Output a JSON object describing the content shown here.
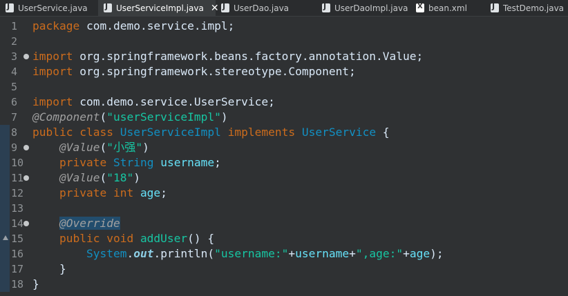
{
  "tabs": [
    {
      "label": "UserService.java",
      "icon": "java-file-icon",
      "active": false
    },
    {
      "label": "UserServiceImpl.java",
      "icon": "java-file-icon",
      "active": true
    },
    {
      "label": "UserDao.java",
      "icon": "java-file-icon",
      "active": false
    },
    {
      "label": "UserDaoImpl.java",
      "icon": "java-file-icon",
      "active": false
    },
    {
      "label": "bean.xml",
      "icon": "xml-file-icon",
      "active": false
    },
    {
      "label": "TestDemo.java",
      "icon": "java-file-icon",
      "active": false
    }
  ],
  "close_glyph": "✕",
  "lines": [
    {
      "n": "1",
      "fold": false,
      "tokens": [
        [
          "kw",
          "package"
        ],
        [
          "plain",
          " com.demo.service.impl;"
        ]
      ]
    },
    {
      "n": "2",
      "fold": false,
      "tokens": []
    },
    {
      "n": "3",
      "fold": true,
      "tokens": [
        [
          "kw",
          "import"
        ],
        [
          "plain",
          " org.springframework.beans.factory.annotation.Value;"
        ]
      ]
    },
    {
      "n": "4",
      "fold": false,
      "tokens": [
        [
          "kw",
          "import"
        ],
        [
          "plain",
          " org.springframework.stereotype.Component;"
        ]
      ]
    },
    {
      "n": "5",
      "fold": false,
      "tokens": []
    },
    {
      "n": "6",
      "fold": false,
      "tokens": [
        [
          "kw",
          "import"
        ],
        [
          "plain",
          " com.demo.service.UserService;"
        ]
      ]
    },
    {
      "n": "7",
      "fold": false,
      "tokens": [
        [
          "ann",
          "@Component"
        ],
        [
          "plain",
          "("
        ],
        [
          "str",
          "\"userServiceImpl\""
        ],
        [
          "plain",
          ")"
        ]
      ]
    },
    {
      "n": "8",
      "fold": false,
      "tokens": [
        [
          "kw",
          "public class"
        ],
        [
          "plain",
          " "
        ],
        [
          "type",
          "UserServiceImpl"
        ],
        [
          "plain",
          " "
        ],
        [
          "kw",
          "implements"
        ],
        [
          "plain",
          " "
        ],
        [
          "type",
          "UserService"
        ],
        [
          "plain",
          " {"
        ]
      ]
    },
    {
      "n": "9",
      "fold": true,
      "tokens": [
        [
          "plain",
          "    "
        ],
        [
          "ann",
          "@Value"
        ],
        [
          "plain",
          "("
        ],
        [
          "str",
          "\"小强\""
        ],
        [
          "plain",
          ")"
        ]
      ]
    },
    {
      "n": "10",
      "fold": false,
      "tokens": [
        [
          "plain",
          "    "
        ],
        [
          "kw",
          "private"
        ],
        [
          "plain",
          " "
        ],
        [
          "type",
          "String"
        ],
        [
          "plain",
          " "
        ],
        [
          "field",
          "username"
        ],
        [
          "plain",
          ";"
        ]
      ]
    },
    {
      "n": "11",
      "fold": true,
      "tokens": [
        [
          "plain",
          "    "
        ],
        [
          "ann",
          "@Value"
        ],
        [
          "plain",
          "("
        ],
        [
          "str",
          "\"18\""
        ],
        [
          "plain",
          ")"
        ]
      ]
    },
    {
      "n": "12",
      "fold": false,
      "tokens": [
        [
          "plain",
          "    "
        ],
        [
          "kw",
          "private int"
        ],
        [
          "plain",
          " "
        ],
        [
          "field",
          "age"
        ],
        [
          "plain",
          ";"
        ]
      ]
    },
    {
      "n": "13",
      "fold": false,
      "tokens": []
    },
    {
      "n": "14",
      "fold": true,
      "tokens": [
        [
          "plain",
          "    "
        ],
        [
          "selected",
          "@Override"
        ]
      ]
    },
    {
      "n": "15",
      "fold": false,
      "override": true,
      "tokens": [
        [
          "plain",
          "    "
        ],
        [
          "kw",
          "public void"
        ],
        [
          "plain",
          " "
        ],
        [
          "str",
          "addUser"
        ],
        [
          "plain",
          "() {"
        ]
      ]
    },
    {
      "n": "16",
      "fold": false,
      "tokens": [
        [
          "plain",
          "        "
        ],
        [
          "type",
          "System"
        ],
        [
          "plain",
          "."
        ],
        [
          "sfield",
          "out"
        ],
        [
          "plain",
          ".println("
        ],
        [
          "str",
          "\"username:\""
        ],
        [
          "plain",
          "+"
        ],
        [
          "field",
          "username"
        ],
        [
          "plain",
          "+"
        ],
        [
          "str",
          "\",age:\""
        ],
        [
          "plain",
          "+"
        ],
        [
          "field",
          "age"
        ],
        [
          "plain",
          ");"
        ]
      ]
    },
    {
      "n": "17",
      "fold": false,
      "tokens": [
        [
          "plain",
          "    }"
        ]
      ]
    },
    {
      "n": "18",
      "fold": false,
      "tokens": [
        [
          "plain",
          "}"
        ]
      ]
    }
  ]
}
